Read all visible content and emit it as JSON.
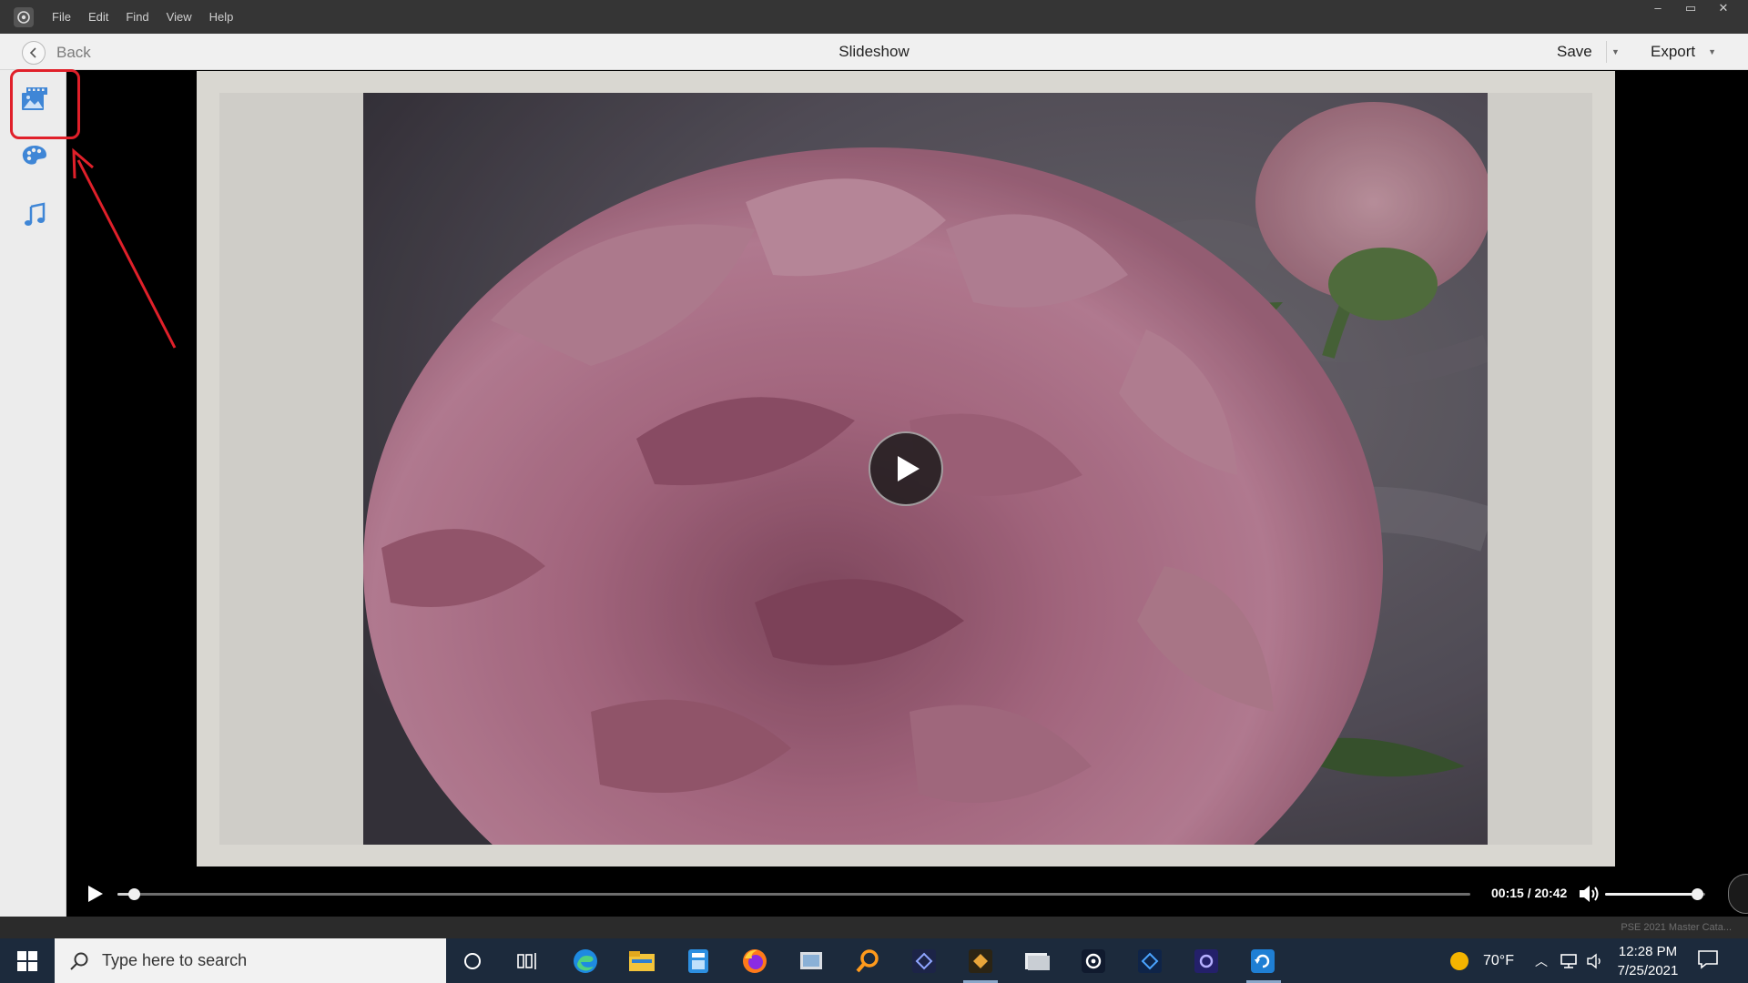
{
  "menubar": {
    "items": [
      "File",
      "Edit",
      "Find",
      "View",
      "Help"
    ],
    "window_controls": [
      "–",
      "▭",
      "✕"
    ]
  },
  "header": {
    "back_label": "Back",
    "title": "Slideshow",
    "save_label": "Save",
    "export_label": "Export"
  },
  "left_panel": {
    "items": [
      {
        "name": "media-icon",
        "selected": true
      },
      {
        "name": "themes-palette-icon",
        "selected": false
      },
      {
        "name": "audio-music-icon",
        "selected": false
      }
    ]
  },
  "player": {
    "time_display": "00:15 / 20:42",
    "progress": 0.012,
    "volume": 0.92
  },
  "status": {
    "catalog_name": "PSE 2021 Master Cata..."
  },
  "taskbar": {
    "search_placeholder": "Type here to search",
    "weather": "70°F",
    "time": "12:28 PM",
    "date": "7/25/2021"
  },
  "colors": {
    "highlight": "#e0202a",
    "accent_blue": "#3f86d6",
    "taskbar_bg": "#1c2a3c"
  }
}
